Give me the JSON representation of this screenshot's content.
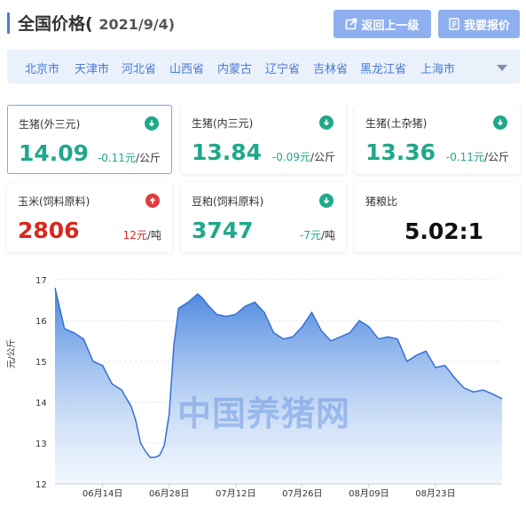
{
  "header": {
    "title": "全国价格(",
    "date": "2021/9/4)",
    "back_label": "返回上一级",
    "report_label": "我要报价"
  },
  "regions": [
    "北京市",
    "天津市",
    "河北省",
    "山西省",
    "内蒙古",
    "辽宁省",
    "吉林省",
    "黑龙江省",
    "上海市"
  ],
  "cards": [
    {
      "name": "生猪(外三元)",
      "price": "14.09",
      "delta": "-0.11元",
      "unit": "/公斤",
      "trend": "down",
      "active": true
    },
    {
      "name": "生猪(内三元)",
      "price": "13.84",
      "delta": "-0.09元",
      "unit": "/公斤",
      "trend": "down"
    },
    {
      "name": "生猪(土杂猪)",
      "price": "13.36",
      "delta": "-0.11元",
      "unit": "/公斤",
      "trend": "down"
    },
    {
      "name": "玉米(饲料原料)",
      "price": "2806",
      "delta": "12元",
      "unit": "/吨",
      "trend": "up"
    },
    {
      "name": "豆粕(饲料原料)",
      "price": "3747",
      "delta": "-7元",
      "unit": "/吨",
      "trend": "down"
    },
    {
      "name": "猪粮比",
      "price": "5.02:1"
    }
  ],
  "colors": {
    "accent": "#4a7bd6",
    "down": "#1fa88a",
    "up": "#d9271f",
    "button": "#8eb0ef"
  },
  "icons": {
    "back": "external-link-icon",
    "report": "document-icon",
    "down": "down-arrow-circle-icon",
    "up": "up-arrow-circle-icon",
    "regions_more": "caret-down-icon"
  },
  "chart_data": {
    "type": "area",
    "ylabel": "元/公斤",
    "ylim": [
      12,
      17
    ],
    "yticks": [
      12,
      13,
      14,
      15,
      16,
      17
    ],
    "xticks": [
      "06月14日",
      "06月28日",
      "07月12日",
      "07月26日",
      "08月09日",
      "08月23日"
    ],
    "xtick_days": [
      10,
      24,
      38,
      52,
      66,
      80
    ],
    "grid": true,
    "watermark": "中国养猪网",
    "x": [
      0,
      2,
      4,
      6,
      8,
      10,
      12,
      14,
      16,
      17,
      18,
      19,
      20,
      21,
      22,
      23,
      24,
      25,
      26,
      28,
      30,
      31,
      32,
      34,
      36,
      38,
      40,
      42,
      44,
      46,
      48,
      50,
      52,
      54,
      56,
      58,
      60,
      62,
      64,
      66,
      68,
      70,
      72,
      74,
      76,
      78,
      80,
      82,
      84,
      86,
      88,
      90,
      92,
      94
    ],
    "y": [
      16.8,
      15.8,
      15.7,
      15.55,
      15.0,
      14.9,
      14.45,
      14.3,
      13.9,
      13.55,
      13.0,
      12.8,
      12.65,
      12.65,
      12.7,
      12.95,
      13.7,
      15.4,
      16.3,
      16.45,
      16.65,
      16.55,
      16.4,
      16.15,
      16.1,
      16.15,
      16.35,
      16.45,
      16.2,
      15.7,
      15.55,
      15.6,
      15.85,
      16.2,
      15.75,
      15.5,
      15.6,
      15.7,
      16.0,
      15.85,
      15.55,
      15.6,
      15.55,
      15.0,
      15.15,
      15.25,
      14.85,
      14.9,
      14.6,
      14.35,
      14.25,
      14.3,
      14.2,
      14.09
    ]
  }
}
